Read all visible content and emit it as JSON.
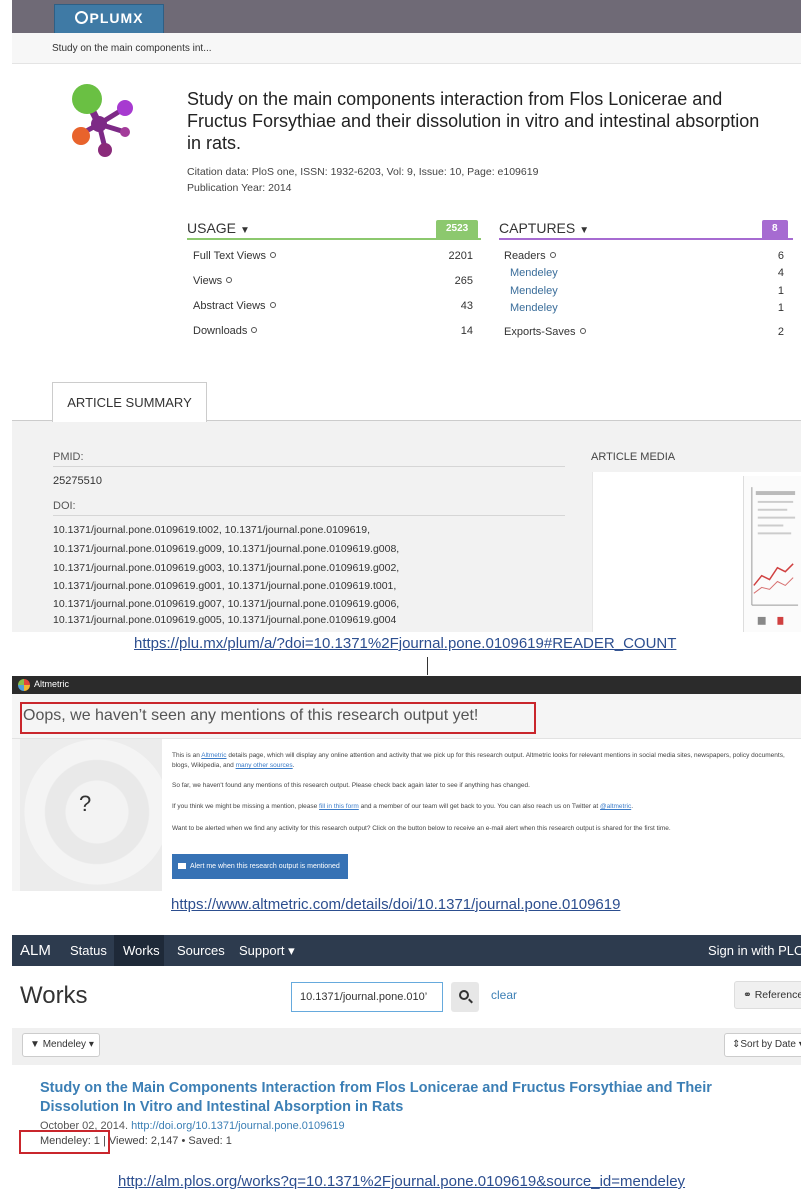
{
  "plumx": {
    "logo_text": "PLUMX",
    "breadcrumb": "Study on the main components int...",
    "title": "Study on the main components interaction from Flos Lonicerae and Fructus Forsythiae and their dissolution in vitro and intestinal absorption in rats.",
    "citation": "Citation data: PloS one, ISSN: 1932-6203, Vol: 9, Issue: 10, Page: e109619",
    "year": "Publication Year: 2014",
    "usage": {
      "label": "USAGE",
      "total": "2523",
      "color": "#8cc86e",
      "rows": [
        {
          "label": "Full Text Views",
          "value": "2201"
        },
        {
          "label": "Views",
          "value": "265"
        },
        {
          "label": "Abstract Views",
          "value": "43"
        },
        {
          "label": "Downloads",
          "value": "14"
        }
      ]
    },
    "captures": {
      "label": "CAPTURES",
      "total": "8",
      "color": "#a66bd1",
      "readers_label": "Readers",
      "readers_value": "6",
      "sub": [
        {
          "label": "Mendeley",
          "value": "4"
        },
        {
          "label": "Mendeley",
          "value": "1"
        },
        {
          "label": "Mendeley",
          "value": "1"
        }
      ],
      "exports_label": "Exports-Saves",
      "exports_value": "2"
    },
    "tab": "ARTICLE SUMMARY",
    "pmid_label": "PMID:",
    "pmid": "25275510",
    "doi_label": "DOI:",
    "doi_lines": [
      "10.1371/journal.pone.0109619.t002,   10.1371/journal.pone.0109619,",
      "10.1371/journal.pone.0109619.g009,   10.1371/journal.pone.0109619.g008,",
      "10.1371/journal.pone.0109619.g003,   10.1371/journal.pone.0109619.g002,",
      "10.1371/journal.pone.0109619.g001,   10.1371/journal.pone.0109619.t001,",
      "10.1371/journal.pone.0109619.g007,   10.1371/journal.pone.0109619.g006,",
      "10.1371/journal.pone.0109619.g005,   10.1371/journal.pone.0109619.g004"
    ],
    "media_label": "ARTICLE MEDIA"
  },
  "url1": "https://plu.mx/plum/a/?doi=10.1371%2Fjournal.pone.0109619#READER_COUNT",
  "altmetric": {
    "brand": "Altmetric",
    "headline": "Oops, we haven’t seen any mentions of this research output yet!",
    "question": "?",
    "p1_a": "This is an ",
    "p1_link": "Altmetric",
    "p1_b": " details page, which will display any online attention and activity that we pick up for this research output. Altmetric looks for relevant mentions in social media sites, newspapers, policy documents, blogs, Wikipedia, and ",
    "p1_link2": "many other sources",
    "p1_c": ".",
    "p2": "So far, we haven't found any mentions of this research output. Please check back again later to see if anything has changed.",
    "p3_a": "If you think we might be missing a mention, please ",
    "p3_link": "fill in this form",
    "p3_b": " and a member of our team will get back to you. You can also reach us on Twitter at ",
    "p3_link2": "@altmetric",
    "p3_c": ".",
    "p4": "Want to be alerted when we find any activity for this research output? Click on the button below to receive an e-mail alert when this research output is shared for the first time.",
    "button": "Alert me when this research output is mentioned"
  },
  "url2": "https://www.altmetric.com/details/doi/10.1371/journal.pone.0109619",
  "alm": {
    "nav": {
      "brand": "ALM",
      "status": "Status",
      "works": "Works",
      "sources": "Sources",
      "support": "Support ▾",
      "signin": "Sign in with PLOS"
    },
    "heading": "Works",
    "search_value": "10.1371/journal.pone.010’",
    "clear": "clear",
    "references": "References",
    "filter": "Mendeley ▾",
    "sort": "Sort by Date ▾",
    "work_title": "Study on the Main Components Interaction from Flos Lonicerae and Fructus Forsythiae and Their Dissolution In Vitro and Intestinal Absorption in Rats",
    "date": "October 02, 2014.",
    "doi_link": "http://doi.org/10.1371/journal.pone.0109619",
    "stats_mendeley": "Mendeley: 1",
    "stats_rest": " | Viewed: 2,147 • Saved: 1"
  },
  "url3": "http://alm.plos.org/works?q=10.1371%2Fjournal.pone.0109619&source_id=mendeley"
}
